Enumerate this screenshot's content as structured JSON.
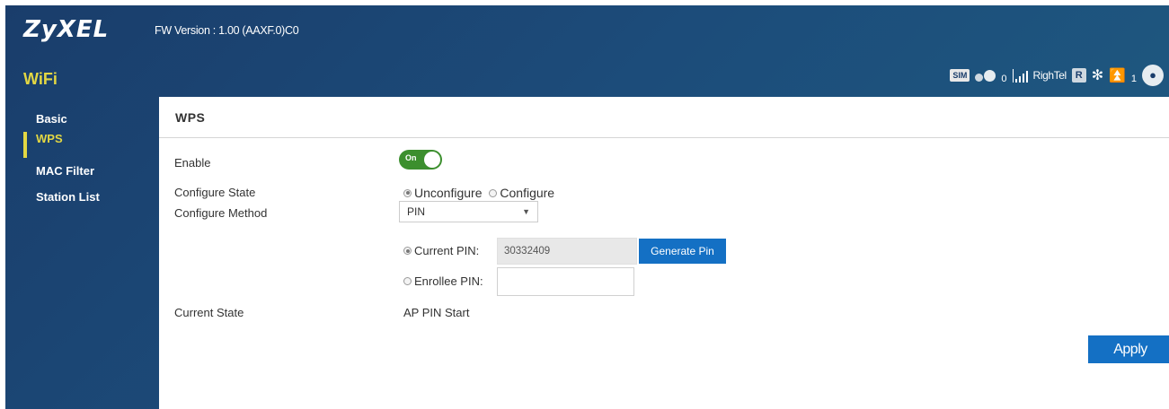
{
  "header": {
    "brand": "ZyXEL",
    "fw_version": "FW Version : 1.00 (AAXF.0)C0",
    "section_title": "WiFi"
  },
  "status": {
    "sim_label": "SIM",
    "messages_count": "0",
    "operator": "RighTel",
    "r_label": "R",
    "clients_count": "1"
  },
  "sidebar": {
    "items": [
      {
        "label": "Basic",
        "active": false
      },
      {
        "label": "WPS",
        "active": true
      },
      {
        "label": "MAC Filter",
        "active": false
      },
      {
        "label": "Station List",
        "active": false
      }
    ]
  },
  "panel": {
    "title": "WPS",
    "enable_label": "Enable",
    "toggle_text": "On",
    "configure_state_label": "Configure State",
    "state_options": [
      "Unconfigure",
      "Configure"
    ],
    "state_selected": "Unconfigure",
    "configure_method_label": "Configure Method",
    "method_value": "PIN",
    "current_pin_label": "Current PIN:",
    "current_pin_value": "30332409",
    "generate_pin_label": "Generate Pin",
    "enrollee_pin_label": "Enrollee PIN:",
    "enrollee_pin_value": "",
    "current_state_label": "Current State",
    "current_state_value": "AP PIN Start",
    "apply_label": "Apply"
  },
  "colors": {
    "header_bg": "#1c4c7a",
    "accent_yellow": "#e3d743",
    "button_blue": "#1470c4",
    "toggle_green": "#3c8f2e"
  }
}
